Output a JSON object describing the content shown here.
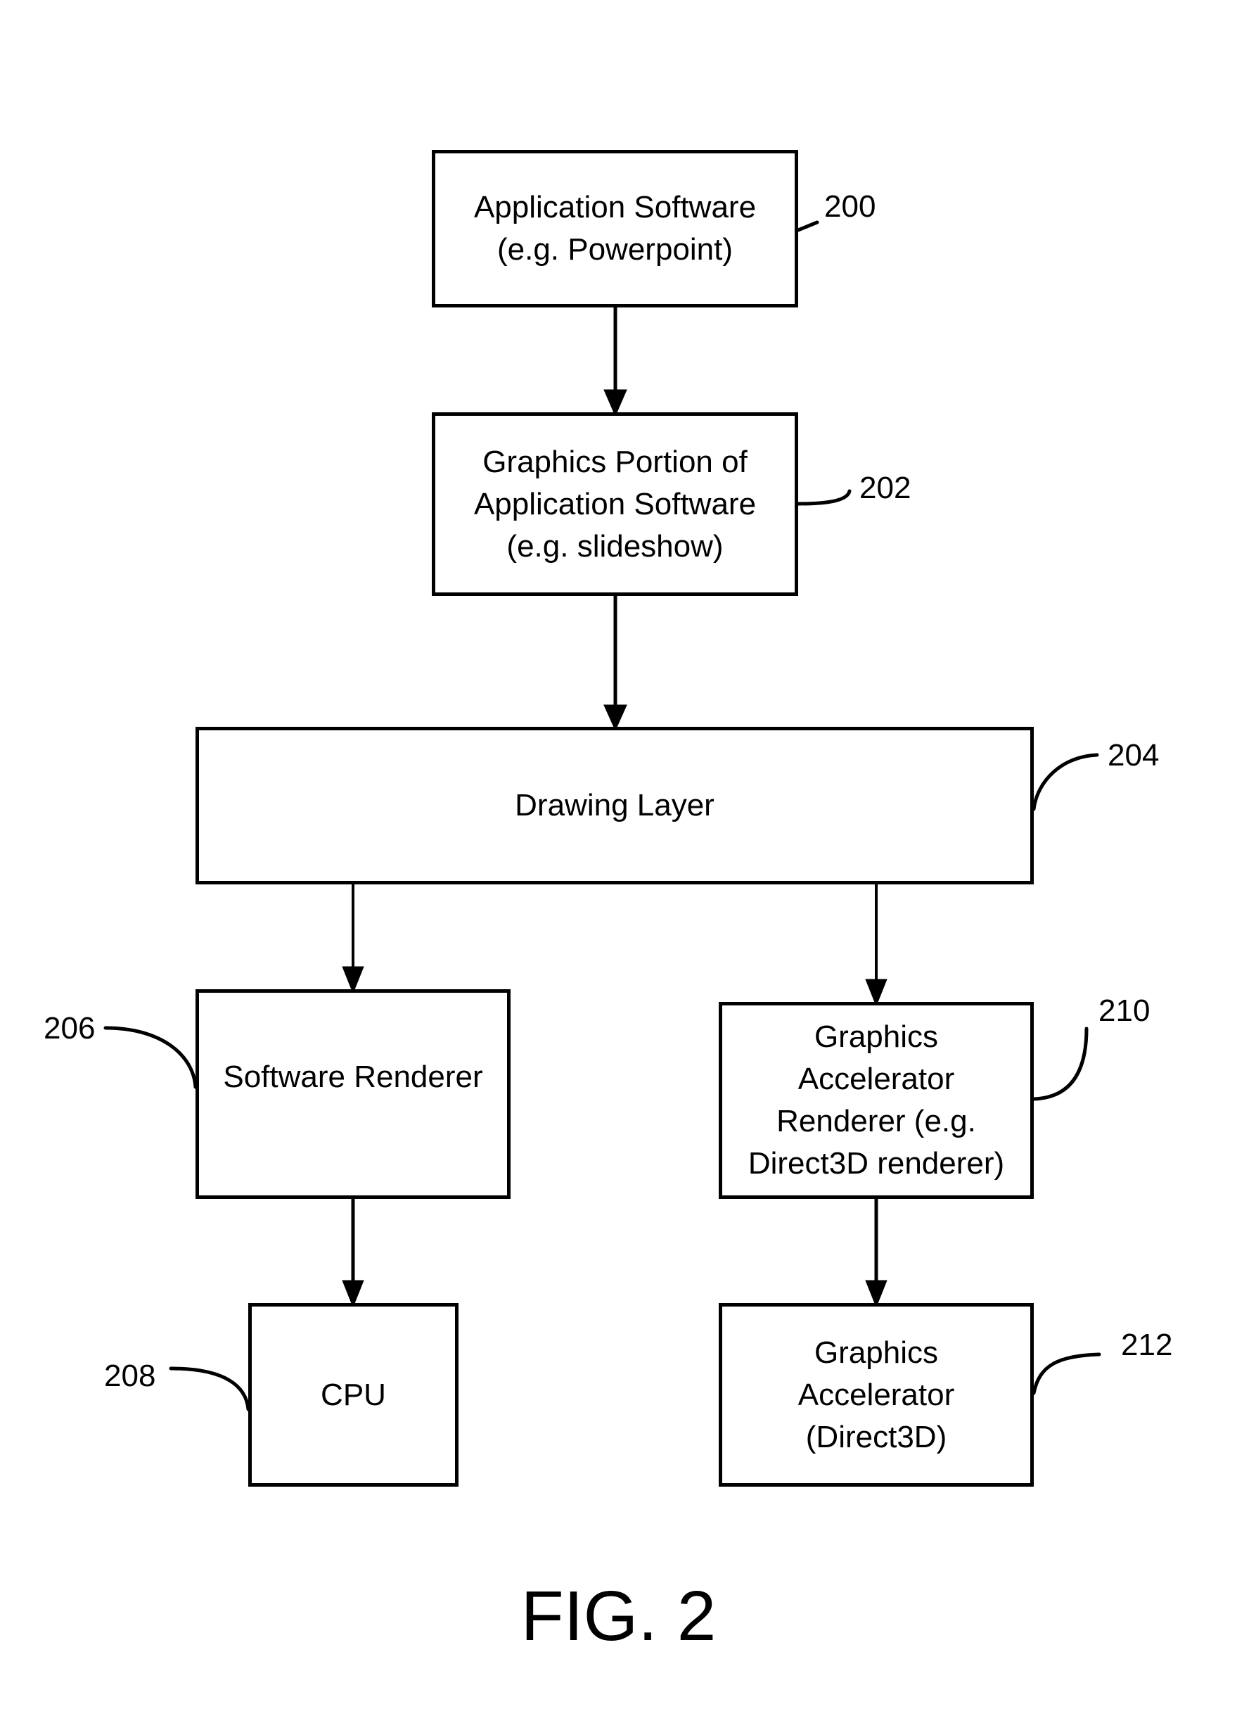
{
  "figure_label": "FIG. 2",
  "nodes": {
    "app": {
      "ref": "200",
      "text": "Application Software\n(e.g. Powerpoint)"
    },
    "graphics": {
      "ref": "202",
      "text": "Graphics Portion of\nApplication Software\n(e.g. slideshow)"
    },
    "drawing": {
      "ref": "204",
      "text": "Drawing Layer"
    },
    "software_renderer": {
      "ref": "206",
      "text": "Software Renderer"
    },
    "cpu": {
      "ref": "208",
      "text": "CPU"
    },
    "accel_renderer": {
      "ref": "210",
      "text": "Graphics\nAccelerator\nRenderer (e.g.\nDirect3D renderer)"
    },
    "accelerator": {
      "ref": "212",
      "text": "Graphics\nAccelerator\n(Direct3D)"
    }
  },
  "edges": [
    {
      "from": "200",
      "to": "202"
    },
    {
      "from": "202",
      "to": "204"
    },
    {
      "from": "204",
      "to": "206"
    },
    {
      "from": "204",
      "to": "210"
    },
    {
      "from": "206",
      "to": "208"
    },
    {
      "from": "210",
      "to": "212"
    }
  ]
}
